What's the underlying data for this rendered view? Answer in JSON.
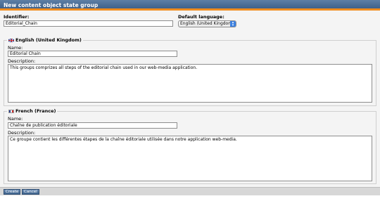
{
  "window": {
    "title": "New content object state group"
  },
  "form": {
    "identifier_label": "Identifier:",
    "identifier_value": "Editorial_Chain",
    "default_language_label": "Default language:",
    "default_language_value": "English (United Kingdom)"
  },
  "languages": [
    {
      "name": "English (United Kingdom)",
      "flag": "uk-flag",
      "name_label": "Name:",
      "name_value": "Editorial Chain",
      "description_label": "Description:",
      "description_value": "This groups comprizes all steps of the editorial chain used in our web-media application."
    },
    {
      "name": "French (France)",
      "flag": "fr-flag",
      "name_label": "Name:",
      "name_value": "Chaîne de publication éditoriale",
      "description_label": "Description:",
      "description_value": "Ce groupe contient les différentes étapes de la chaîne éditoriale utilisée dans notre application web-media."
    }
  ],
  "buttons": {
    "create": "Create",
    "cancel": "Cancel"
  },
  "colors": {
    "title_bg": "#4a6d96",
    "accent": "#f08c1e",
    "select_arrow": "#3b80e0"
  }
}
